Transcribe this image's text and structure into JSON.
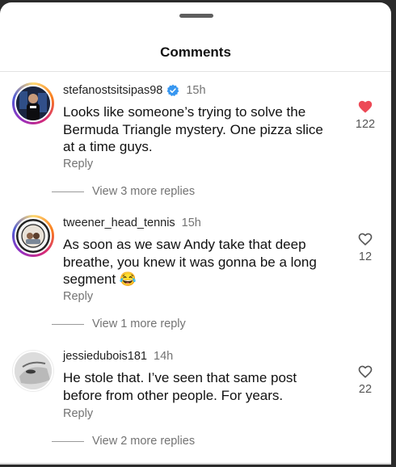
{
  "sheet": {
    "title": "Comments"
  },
  "comments": [
    {
      "username": "stefanostsitsipas98",
      "verified": true,
      "time": "15h",
      "text": "Looks like someone’s trying to solve the Bermuda Triangle mystery. One pizza slice at a time guys.",
      "reply_label": "Reply",
      "view_replies": "View 3 more replies",
      "likes": "122",
      "liked": true
    },
    {
      "username": "tweener_head_tennis",
      "verified": false,
      "time": "15h",
      "text": "As soon as we saw Andy take that deep breathe, you knew it was gonna be a long segment 😂",
      "reply_label": "Reply",
      "view_replies": "View 1 more reply",
      "likes": "12",
      "liked": false
    },
    {
      "username": "jessiedubois181",
      "verified": false,
      "time": "14h",
      "text": "He stole that. I’ve seen that same post before from other people. For years.",
      "reply_label": "Reply",
      "view_replies": "View 2 more replies",
      "likes": "22",
      "liked": false
    }
  ],
  "colors": {
    "like_red": "#ed4956",
    "verified_blue": "#3897f0",
    "muted": "#737373"
  },
  "icons": [
    "heart-icon",
    "verified-badge-icon"
  ]
}
